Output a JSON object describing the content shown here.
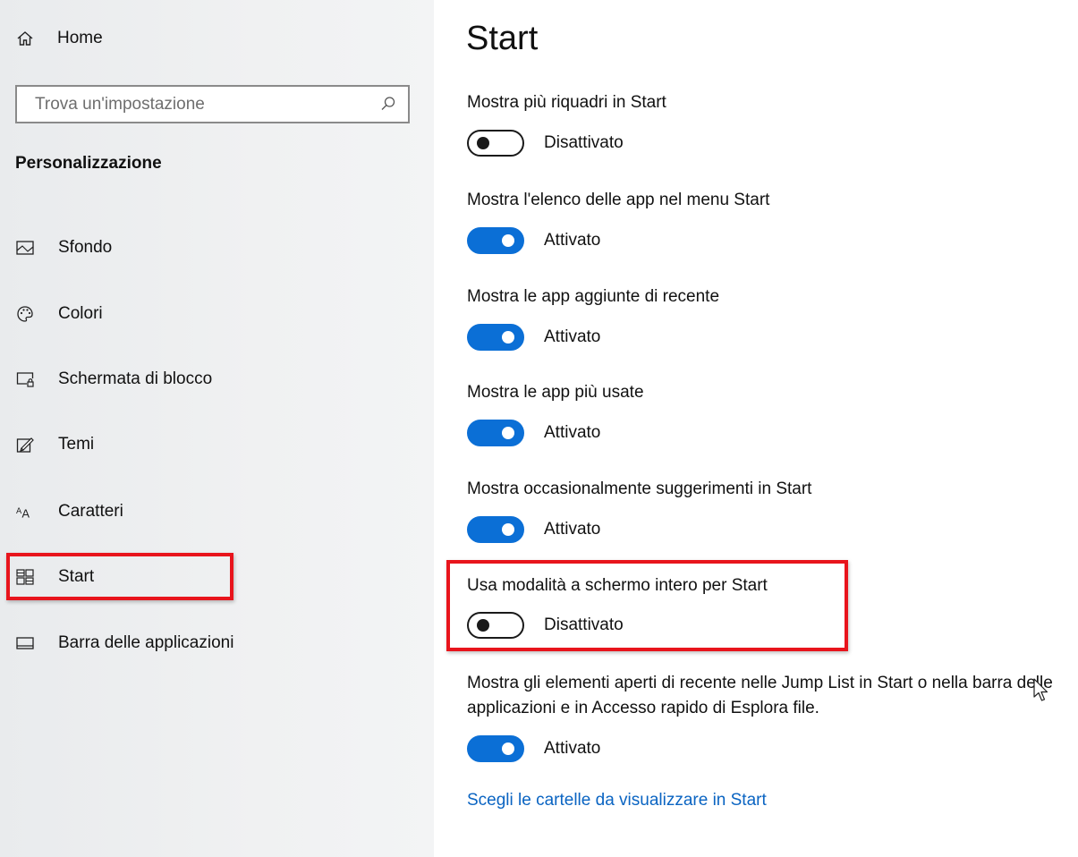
{
  "sidebar": {
    "home_label": "Home",
    "search_placeholder": "Trova un'impostazione",
    "section_title": "Personalizzazione",
    "items": [
      {
        "label": "Sfondo",
        "icon": "image-icon"
      },
      {
        "label": "Colori",
        "icon": "palette-icon"
      },
      {
        "label": "Schermata di blocco",
        "icon": "lock-screen-icon"
      },
      {
        "label": "Temi",
        "icon": "themes-icon"
      },
      {
        "label": "Caratteri",
        "icon": "fonts-icon"
      },
      {
        "label": "Start",
        "icon": "start-tiles-icon",
        "selected": true
      },
      {
        "label": "Barra delle applicazioni",
        "icon": "taskbar-icon"
      }
    ]
  },
  "main": {
    "title": "Start",
    "settings": [
      {
        "label": "Mostra più riquadri in Start",
        "state": "Disattivato",
        "on": false
      },
      {
        "label": "Mostra l'elenco delle app nel menu Start",
        "state": "Attivato",
        "on": true
      },
      {
        "label": "Mostra le app aggiunte di recente",
        "state": "Attivato",
        "on": true
      },
      {
        "label": "Mostra le app più usate",
        "state": "Attivato",
        "on": true
      },
      {
        "label": "Mostra occasionalmente suggerimenti in Start",
        "state": "Attivato",
        "on": true
      },
      {
        "label": "Usa modalità a schermo intero per Start",
        "state": "Disattivato",
        "on": false
      },
      {
        "label": "Mostra gli elementi aperti di recente nelle Jump List in Start o nella barra delle applicazioni e in Accesso rapido di Esplora file.",
        "state": "Attivato",
        "on": true
      }
    ],
    "link": "Scegli le cartelle da visualizzare in Start"
  },
  "colors": {
    "accent": "#0b6fd6",
    "link": "#0a64c2",
    "highlight": "#e8141c"
  }
}
